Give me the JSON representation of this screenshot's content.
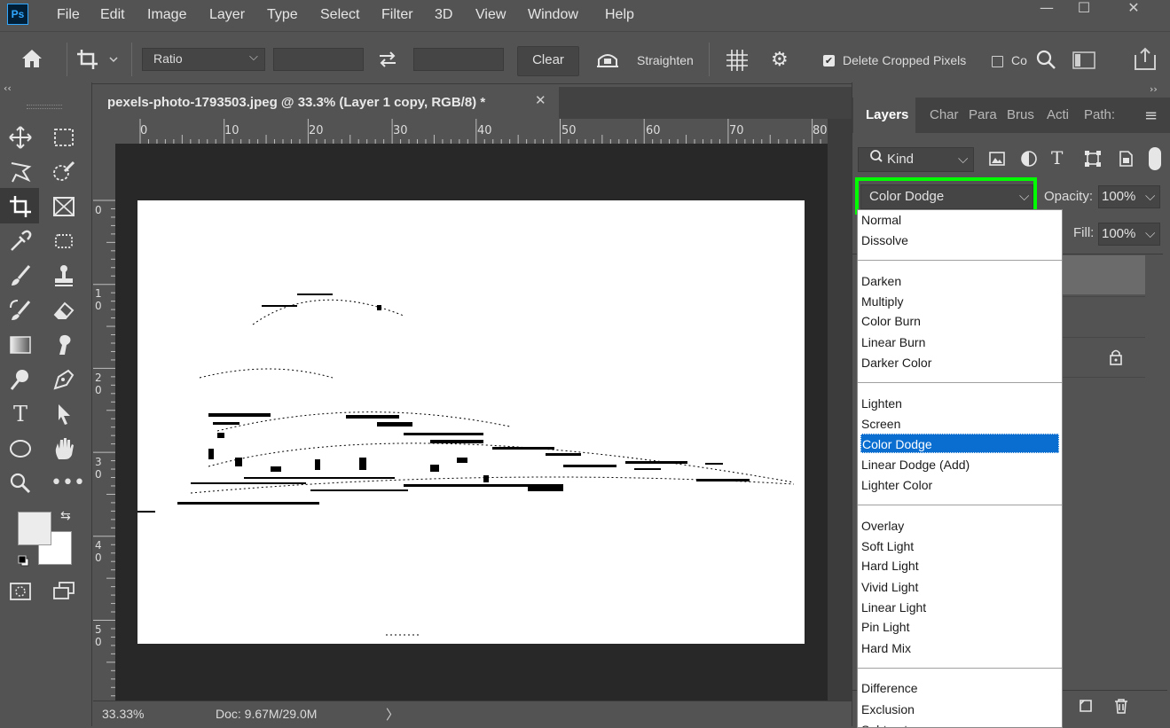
{
  "app": {
    "logo": "Ps"
  },
  "menu": [
    "File",
    "Edit",
    "Image",
    "Layer",
    "Type",
    "Select",
    "Filter",
    "3D",
    "View",
    "Window",
    "Help"
  ],
  "window_controls": {
    "minimize": "—",
    "maximize": "☐",
    "close": "✕"
  },
  "options": {
    "ratio_label": "Ratio",
    "clear_label": "Clear",
    "straighten_label": "Straighten",
    "delete_cropped_label": "Delete Cropped Pixels",
    "content_aware_label": "Co",
    "delete_cropped_checked": true
  },
  "document": {
    "tab_title": "pexels-photo-1793503.jpeg @ 33.3% (Layer 1 copy, RGB/8) *",
    "ruler_top": [
      "0",
      "10",
      "20",
      "30",
      "40",
      "50",
      "60",
      "70",
      "80"
    ],
    "ruler_left": [
      [
        "0"
      ],
      [
        "1",
        "0"
      ],
      [
        "2",
        "0"
      ],
      [
        "3",
        "0"
      ],
      [
        "4",
        "0"
      ],
      [
        "5",
        "0"
      ]
    ],
    "zoom": "33.33%",
    "doc_size": "Doc: 9.67M/29.0M"
  },
  "layers_panel": {
    "tabs": [
      "Layers",
      "Char",
      "Para",
      "Brus",
      "Acti",
      "Path:"
    ],
    "filter_kind": "Kind",
    "blend_mode": "Color Dodge",
    "opacity_label": "Opacity:",
    "opacity_value": "100%",
    "fill_label": "Fill:",
    "fill_value": "100%",
    "highlight_color": "#00ff00"
  },
  "blend_modes": {
    "groups": [
      [
        "Normal",
        "Dissolve"
      ],
      [
        "Darken",
        "Multiply",
        "Color Burn",
        "Linear Burn",
        "Darker Color"
      ],
      [
        "Lighten",
        "Screen",
        "Color Dodge",
        "Linear Dodge (Add)",
        "Lighter Color"
      ],
      [
        "Overlay",
        "Soft Light",
        "Hard Light",
        "Vivid Light",
        "Linear Light",
        "Pin Light",
        "Hard Mix"
      ],
      [
        "Difference",
        "Exclusion",
        "Subtract"
      ]
    ],
    "selected": "Color Dodge",
    "selected_color": "#0a6ed1"
  }
}
